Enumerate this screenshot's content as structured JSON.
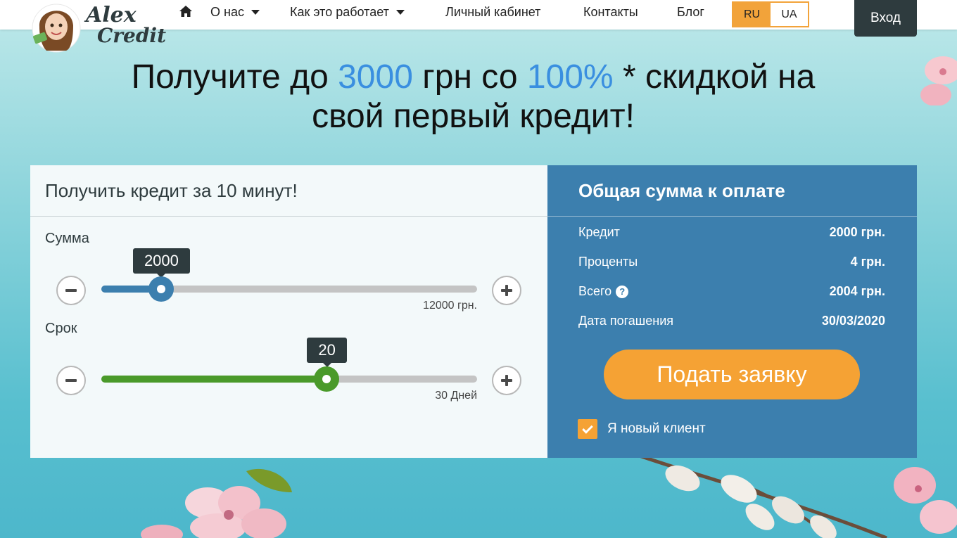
{
  "header": {
    "logo_text_top": "Alex",
    "logo_text_bottom": "Credit",
    "nav": [
      {
        "label": "О нас",
        "has_dropdown": true
      },
      {
        "label": "Как это работает",
        "has_dropdown": true
      },
      {
        "label": "Личный кабинет",
        "has_dropdown": false
      },
      {
        "label": "Контакты",
        "has_dropdown": false
      },
      {
        "label": "Блог",
        "has_dropdown": false
      }
    ],
    "languages": [
      "RU",
      "UA"
    ],
    "active_language": "RU",
    "login_label": "Вход"
  },
  "headline": {
    "part1": "Получите до ",
    "accent1": "3000",
    "part2": " грн со ",
    "accent2": "100%",
    "part3": " * скидкой на",
    "line2": "свой первый кредит!"
  },
  "calculator": {
    "title": "Получить кредит за 10 минут!",
    "amount": {
      "label": "Сумма",
      "value": "2000",
      "max_label": "12000 грн.",
      "fraction": 0.16
    },
    "term": {
      "label": "Срок",
      "value": "20",
      "max_label": "30 Дней",
      "fraction": 0.6
    }
  },
  "summary": {
    "title": "Общая сумма к оплате",
    "rows": [
      {
        "label": "Кредит",
        "value": "2000 грн."
      },
      {
        "label": "Проценты",
        "value": "4 грн."
      },
      {
        "label": "Всего",
        "value": "2004 грн.",
        "help": "?"
      },
      {
        "label": "Дата погашения",
        "value": "30/03/2020"
      }
    ],
    "apply_label": "Подать заявку",
    "new_client_label": "Я новый клиент",
    "new_client_checked": true
  },
  "colors": {
    "accent_blue": "#3a8fe0",
    "orange": "#f5a234",
    "panel_blue": "#3c7fae",
    "slider_blue": "#3c7fae",
    "slider_green": "#4a9a2a",
    "dark": "#2e3b3e"
  }
}
